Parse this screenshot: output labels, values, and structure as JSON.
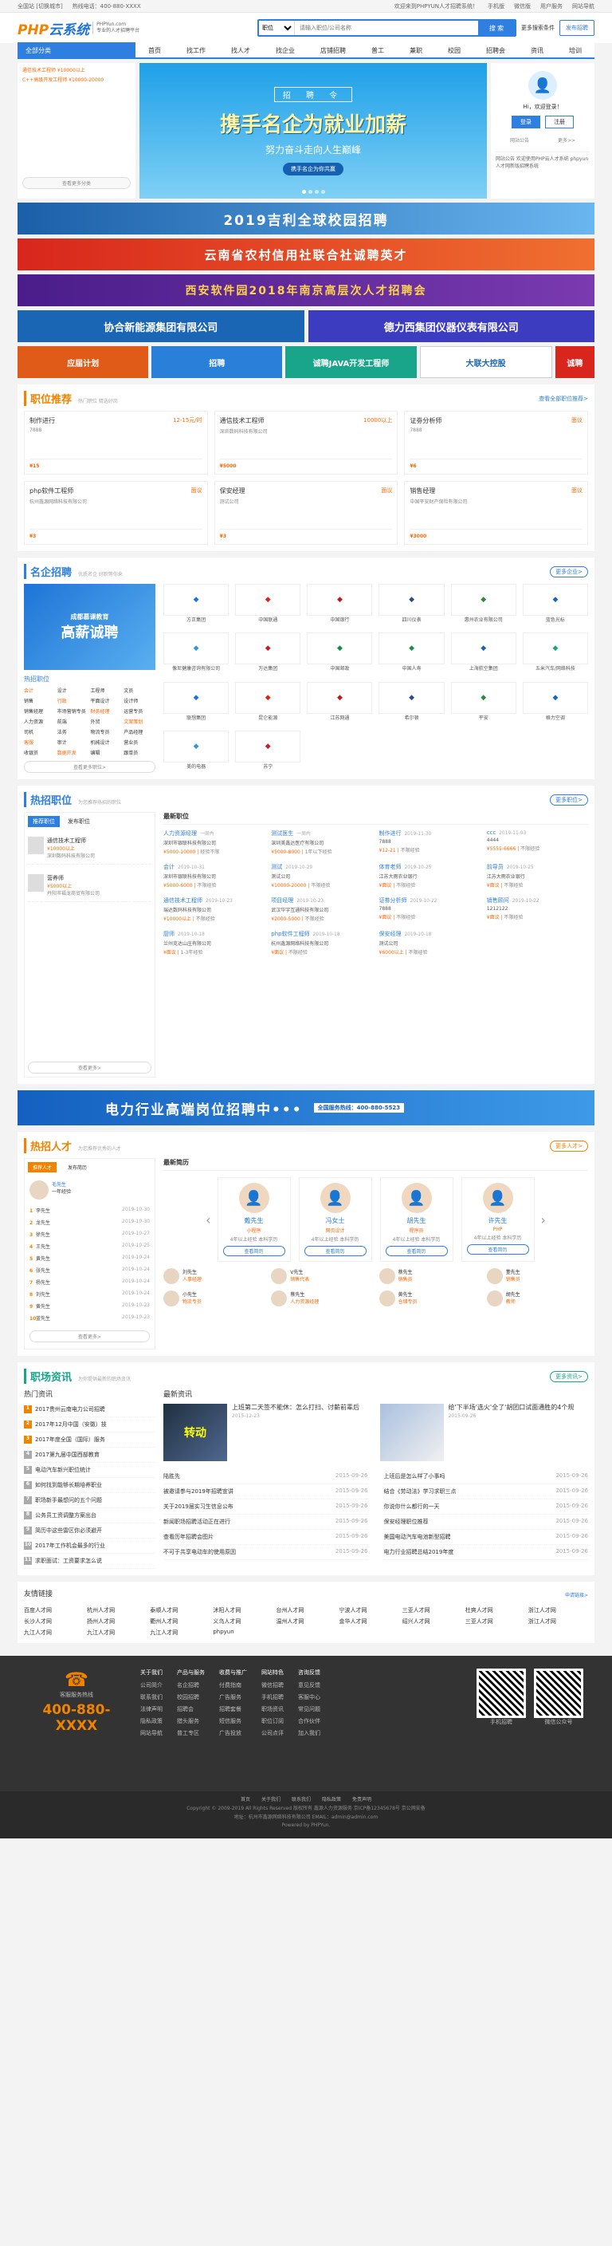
{
  "top": {
    "city": "全国站 [切换城市]",
    "tel": "热线电话：400-880-XXXX",
    "welcome": "欢迎来到PHPYUN人才招聘系统！",
    "links": [
      "手机版",
      "微信版",
      "用户服务",
      "网站导航"
    ]
  },
  "logo": {
    "mark": "PHP",
    "mark2": "云系统",
    "sub1": "PHPYun.com",
    "sub2": "专业的人才招聘平台"
  },
  "search": {
    "type": "职位",
    "placeholder": "请输入职位/公司名称",
    "btn": "搜 索",
    "more": "更多搜索条件",
    "pub": "发布招聘"
  },
  "nav": {
    "cat": "全部分类",
    "items": [
      "首页",
      "找工作",
      "找人才",
      "找企业",
      "店铺招聘",
      "普工",
      "兼职",
      "校园",
      "招聘会",
      "资讯",
      "培训"
    ]
  },
  "catlist": [
    "通信技术工程师 ¥10000以上",
    "C++高级开发工程师 ¥10000-20000"
  ],
  "catmore": "查看更多分类",
  "banner": {
    "t0": "招 聘 令",
    "t1": "携手名企为就业加薪",
    "t2": "努力奋斗走向人生巅峰",
    "t3": "携手名企为你共赢"
  },
  "user": {
    "hi": "Hi，欢迎登录！",
    "login": "登录",
    "reg": "注册",
    "icons": [
      "网站公告",
      "更多>>"
    ],
    "notice": "网站公告 欢迎使用PHP云人才系统 phpyun人才网新版招聘系统"
  },
  "ads": {
    "a1": "2019吉利全球校园招聘",
    "a2": "云南省农村信用社联合社诚聘英才",
    "a3": "西安软件园2018年南京高层次人才招聘会",
    "a4": "协合新能源集团有限公司",
    "a5": "德力西集团仪器仪表有限公司",
    "a6": [
      "应届计划",
      "招聘",
      "诚聘JAVA开发工程师",
      "大联大控股",
      "诚聘"
    ]
  },
  "jobs": {
    "title": "职位推荐",
    "sub": "热门职位 精选好岗",
    "more": "查看全部职位推荐>",
    "items": [
      {
        "n": "制作进行",
        "s": "12-15元/时",
        "c": "7888",
        "p": "¥15"
      },
      {
        "n": "通信技术工程师",
        "s": "10000以上",
        "c": "深圳数码科技有限公司",
        "p": "¥5000"
      },
      {
        "n": "证劵分析师",
        "s": "面议",
        "c": "7888",
        "p": "¥6"
      },
      {
        "n": "php软件工程师",
        "s": "面议",
        "c": "杭州鑫源网络科技有限公司",
        "p": "¥3"
      },
      {
        "n": "保安经理",
        "s": "面议",
        "c": "测试公司",
        "p": "¥3"
      },
      {
        "n": "销售经理",
        "s": "面议",
        "c": "中国平安财产保险有限公司",
        "p": "¥3000"
      }
    ]
  },
  "comp": {
    "title": "名企招聘",
    "sub": "优质名企 好职等你来",
    "more": "更多企业>",
    "banner": "高薪诚聘",
    "bannersub": "成都慕课教育",
    "hot": "热招职位",
    "tags": [
      "会计",
      "设计",
      "工程师",
      "文员",
      "销售",
      "行政",
      "平面设计",
      "设计师",
      "销售经理",
      "市场营销专员",
      "财务经理",
      "运营专员",
      "人力资源",
      "前端",
      "外贸",
      "文案策划",
      "司机",
      "法务",
      "物流专员",
      "产品经理",
      "客服",
      "审计",
      "机械设计",
      "营业员",
      "收银员",
      "数据开发",
      "编辑",
      "跟单员"
    ],
    "tagmore": "查看更多职位>",
    "logos": [
      "方正集团",
      "中国联通",
      "中国银行",
      "四川仪表",
      "惠州农业有限公司",
      "蓝色光标",
      "像尼健康咨询有限公司",
      "万达集团",
      "中国邮政",
      "中国人寿",
      "上海航空集团",
      "五米汽车/网络科技",
      "联想集团",
      "昆仑能源",
      "江苏网通",
      "希尔顿",
      "平安",
      "格力空调",
      "美的电器",
      "苏宁",
      "中国移动",
      "招商银行",
      "中国电信",
      "江苏华博电器"
    ]
  },
  "hot": {
    "title": "热招职位",
    "sub": "为您推荐热招的职位",
    "more": "更多职位>",
    "tab1": "推荐职位",
    "tab2": "发布职位",
    "recs": [
      {
        "n": "通信技术工程师",
        "s": "¥10000以上",
        "c": "深圳数码科技有限公司"
      },
      {
        "n": "营养师",
        "s": "¥5000以上",
        "c": "丹阳市福龙商贸有限公司"
      }
    ],
    "recmore": "查看更多>",
    "latest_title": "最新职位",
    "latest": [
      {
        "n": "人力资源经理",
        "d": "一周内",
        "c": "深圳市银联科技有限公司",
        "s": "¥5000-10000",
        "x": "经验不限"
      },
      {
        "n": "测试医生",
        "d": "一周内",
        "c": "深圳美鑫达医疗有限公司",
        "s": "¥5000-8000",
        "x": "1年以下经验"
      },
      {
        "n": "制作进行",
        "d": "2019-11-30",
        "c": "7888",
        "s": "¥12-21",
        "x": "不限经验"
      },
      {
        "n": "",
        "d": "",
        "c": "",
        "s": "",
        "x": ""
      },
      {
        "n": "ccc",
        "d": "2019-11-03",
        "c": "4444",
        "s": "¥5555-6666",
        "x": "不限经验"
      },
      {
        "n": "会计",
        "d": "2019-10-31",
        "c": "深圳市银联科技有限公司",
        "s": "¥5000-6000",
        "x": "不限经验"
      },
      {
        "n": "测试",
        "d": "2019-10-29",
        "c": "测试公司",
        "s": "¥10000-20000",
        "x": "不限经验"
      },
      {
        "n": "",
        "d": "",
        "c": "",
        "s": "",
        "x": ""
      },
      {
        "n": "体育老师",
        "d": "2019-10-25",
        "c": "江苏大雨农业银行",
        "s": "¥面议",
        "x": "不限经验"
      },
      {
        "n": "前导员",
        "d": "2019-10-25",
        "c": "江苏大雨农业银行",
        "s": "¥面议",
        "x": "不限经验"
      },
      {
        "n": "通信技术工程师",
        "d": "2019-10-23",
        "c": "瑞达数码科技有限公司",
        "s": "¥10000以上",
        "x": "不限经验"
      },
      {
        "n": "",
        "d": "",
        "c": "",
        "s": "",
        "x": ""
      },
      {
        "n": "项目经理",
        "d": "2019-10-23",
        "c": "武汉华宇互通科技有限公司",
        "s": "¥2000-5000",
        "x": "不限经验"
      },
      {
        "n": "证劵分析师",
        "d": "2019-10-22",
        "c": "7888",
        "s": "¥面议",
        "x": "不限经验"
      },
      {
        "n": "销售顾问",
        "d": "2019-10-22",
        "c": "1212122",
        "s": "¥面议",
        "x": "不限经验"
      },
      {
        "n": "",
        "d": "",
        "c": "",
        "s": "",
        "x": ""
      },
      {
        "n": "厨师",
        "d": "2019-10-18",
        "c": "兰州克达山庄有限公司",
        "s": "¥面议",
        "x": "1-3年经验"
      },
      {
        "n": "php软件工程师",
        "d": "2019-10-18",
        "c": "杭州鑫源网络科技有限公司",
        "s": "¥面议",
        "x": "不限经验"
      },
      {
        "n": "保安经理",
        "d": "2019-10-18",
        "c": "测试公司",
        "s": "¥6000以上",
        "x": "不限经验"
      },
      {
        "n": "",
        "d": "",
        "c": "",
        "s": "",
        "x": ""
      }
    ]
  },
  "power": {
    "t": "电力行业高端岗位招聘中•••",
    "tel": "全国服务热线：400-880-5523"
  },
  "talent": {
    "title": "热招人才",
    "sub": "为您推荐优秀的人才",
    "more": "更多人才>",
    "tab1": "推荐人才",
    "tab2": "发布简历",
    "top": {
      "n": "毛先生",
      "j": "一年经验"
    },
    "rows": [
      [
        "李先生",
        "2019-10-30"
      ],
      [
        "龙先生",
        "2019-10-30"
      ],
      [
        "徐先生",
        "2019-10-27"
      ],
      [
        "王先生",
        "2019-10-25"
      ],
      [
        "黄先生",
        "2019-10-24"
      ],
      [
        "张先生",
        "2019-10-24"
      ],
      [
        "杨先生",
        "2019-10-24"
      ],
      [
        "刘先生",
        "2019-10-24"
      ],
      [
        "黄先生",
        "2019-10-23"
      ],
      [
        "蓝先生",
        "2019-10-23"
      ]
    ],
    "more2": "查看更多>",
    "latest_title": "最新简历",
    "cards": [
      {
        "n": "戴先生",
        "j": "小程序",
        "x": "4年以上经验  本科学历"
      },
      {
        "n": "冯女士",
        "j": "网页设计",
        "x": "4年以上经验  本科学历"
      },
      {
        "n": "胡先生",
        "j": "程序员",
        "x": "4年以上经验  本科学历"
      },
      {
        "n": "许先生",
        "j": "PHP",
        "x": "4年以上经验  本科学历"
      }
    ],
    "view": "查看简历",
    "list": [
      {
        "n": "刘先生",
        "j": "人事经理"
      },
      {
        "n": "V先生",
        "j": "销售代表"
      },
      {
        "n": "蔡先生",
        "j": "销售员"
      },
      {
        "n": "董先生",
        "j": "销售员"
      },
      {
        "n": "小先生",
        "j": "物流专员"
      },
      {
        "n": "蔡先生",
        "j": "人力资源经理"
      },
      {
        "n": "黄先生",
        "j": "仓储专员"
      },
      {
        "n": "胡先生",
        "j": "教师"
      }
    ]
  },
  "news": {
    "title": "职场资讯",
    "sub": "为你提供最新的职场资讯",
    "more": "更多资讯>",
    "hot": "热门资讯",
    "latest": "最新资讯",
    "hotlist": [
      "2017贵州云南电力公司招聘",
      "2017年12月中国（安徽）技",
      "2017年度全国（国际）服务",
      "2017第九届中国西部教育",
      "电动汽车新兴职位统计",
      "如何找到能够长期培养职业",
      "职场新手最想问的五个问题",
      "公务员工资调整方案出台",
      "简历中这些雷区你必须避开",
      "2017年工作机会最多的行业",
      "求职面试：工资要求怎么说"
    ],
    "feat": [
      {
        "a": "上班第二天签不能休：怎么打扫、讨薪前辈后",
        "d": "2015-12-23",
        "pic": "转动"
      },
      {
        "a": "给'下半场'选火'全了'胡团口试面通胜的4个规",
        "d": "2015-09-26",
        "pic": ""
      }
    ],
    "list": [
      [
        "陆胜先",
        "2015-09-26"
      ],
      [
        "上班后是怎么样了小事吗",
        "2015-09-26"
      ],
      [
        "被邀请参与2019年招聘宣讲",
        "2015-09-26"
      ],
      [
        "结合《劳动法》学习求职三点",
        "2015-09-26"
      ],
      [
        "关于2019届实习生信息公布",
        "2015-09-26"
      ],
      [
        "你说你什么都行的一天",
        "2015-09-26"
      ],
      [
        "新闻职场招聘活动正在进行",
        "2015-09-26"
      ],
      [
        "保安经理职位推荐",
        "2015-09-26"
      ],
      [
        "查看历年招聘会图片",
        "2015-09-26"
      ],
      [
        "美国电动汽车电池新型招聘",
        "2015-09-26"
      ],
      [
        "不可于共享电动车的使用原因",
        "2015-09-26"
      ],
      [
        "电力行业招聘总结2019年度",
        "2015-09-26"
      ]
    ]
  },
  "links": {
    "title": "友情链接",
    "more": "申请链接>",
    "items": [
      "百度人才网",
      "杭州人才网",
      "泰顺人才网",
      "沭阳人才网",
      "台州人才网",
      "宁波人才网",
      "三亚人才网",
      "杜爽人才网",
      "浙江人才网",
      "长沙人才网",
      "扬州人才网",
      "衢州人才网",
      "义乌人才网",
      "温州人才网",
      "金华人才网",
      "绍兴人才网",
      "三亚人才网",
      "浙江人才网",
      "九江人才网",
      "九江人才网",
      "九江人才网",
      "phpyun"
    ]
  },
  "footer": {
    "tel_label": "客服服务热线",
    "tel": "400-880-XXXX",
    "cols": [
      {
        "h": "关于我们",
        "i": [
          "公司简介",
          "联系我们",
          "法律声明",
          "隐私政策",
          "网站导航"
        ]
      },
      {
        "h": "产品与服务",
        "i": [
          "名企招聘",
          "校园招聘",
          "招聘会",
          "猎头服务",
          "普工专区"
        ]
      },
      {
        "h": "收费与推广",
        "i": [
          "付费指南",
          "广告服务",
          "招聘套餐",
          "短信服务",
          "广告投放"
        ]
      },
      {
        "h": "网站特色",
        "i": [
          "微信招聘",
          "手机招聘",
          "职场资讯",
          "职位订阅",
          "公司点评"
        ]
      },
      {
        "h": "咨询反馈",
        "i": [
          "意见反馈",
          "客服中心",
          "常见问题",
          "合作伙伴",
          "加入我们"
        ]
      }
    ],
    "qr1": "手机招聘",
    "qr2": "微信公众号",
    "nav2": [
      "首页",
      "关于我们",
      "联系我们",
      "隐私政策",
      "免责声明"
    ],
    "copy": "Copyright © 2009-2019 All Rights Reserved 版权所有 鑫源人力资源服务 京ICP备12345678号 京公网安备",
    "copy2": "地址：杭州市鑫源网络科技有限公司 EMAIL：admin@admin.com",
    "powered": "Powered by PHPYun."
  }
}
